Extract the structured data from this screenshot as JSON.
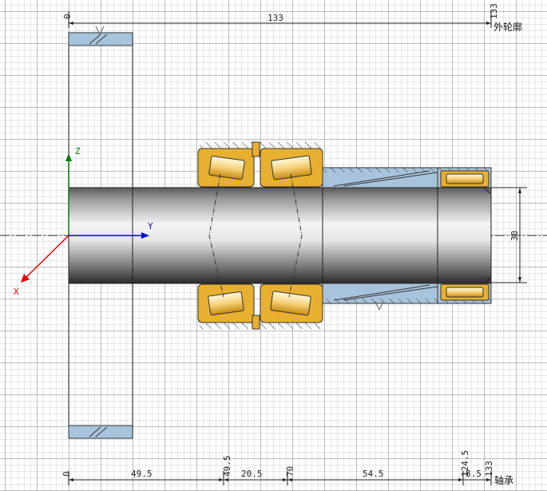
{
  "top_dims": {
    "start": "0",
    "total": "133",
    "end": "133",
    "label": "外轮廓"
  },
  "right_dim": {
    "diameter": "30"
  },
  "bottom_dims": {
    "start": "0",
    "d1": "49.5",
    "d2": "49.5",
    "d3": "20.5",
    "d4": "70",
    "d5": "54.5",
    "d6": "124.5",
    "d7": "8.5",
    "end": "133",
    "label": "轴承"
  },
  "axes": {
    "z": "Z",
    "y": "Y",
    "x": "X"
  },
  "colors": {
    "bearing": "#e8b030",
    "spacer": "#a8c4dc",
    "shaft_dark": "#2a2a2a",
    "axis_z": "#008000",
    "axis_y": "#0000dd",
    "axis_x": "#ee0000"
  }
}
